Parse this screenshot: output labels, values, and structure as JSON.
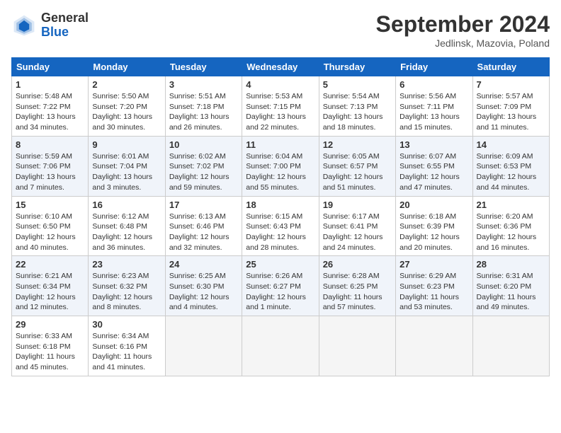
{
  "header": {
    "logo_general": "General",
    "logo_blue": "Blue",
    "month_title": "September 2024",
    "subtitle": "Jedlinsk, Mazovia, Poland"
  },
  "days_of_week": [
    "Sunday",
    "Monday",
    "Tuesday",
    "Wednesday",
    "Thursday",
    "Friday",
    "Saturday"
  ],
  "weeks": [
    {
      "shade": false,
      "days": [
        {
          "num": "1",
          "info": "Sunrise: 5:48 AM\nSunset: 7:22 PM\nDaylight: 13 hours\nand 34 minutes."
        },
        {
          "num": "2",
          "info": "Sunrise: 5:50 AM\nSunset: 7:20 PM\nDaylight: 13 hours\nand 30 minutes."
        },
        {
          "num": "3",
          "info": "Sunrise: 5:51 AM\nSunset: 7:18 PM\nDaylight: 13 hours\nand 26 minutes."
        },
        {
          "num": "4",
          "info": "Sunrise: 5:53 AM\nSunset: 7:15 PM\nDaylight: 13 hours\nand 22 minutes."
        },
        {
          "num": "5",
          "info": "Sunrise: 5:54 AM\nSunset: 7:13 PM\nDaylight: 13 hours\nand 18 minutes."
        },
        {
          "num": "6",
          "info": "Sunrise: 5:56 AM\nSunset: 7:11 PM\nDaylight: 13 hours\nand 15 minutes."
        },
        {
          "num": "7",
          "info": "Sunrise: 5:57 AM\nSunset: 7:09 PM\nDaylight: 13 hours\nand 11 minutes."
        }
      ]
    },
    {
      "shade": true,
      "days": [
        {
          "num": "8",
          "info": "Sunrise: 5:59 AM\nSunset: 7:06 PM\nDaylight: 13 hours\nand 7 minutes."
        },
        {
          "num": "9",
          "info": "Sunrise: 6:01 AM\nSunset: 7:04 PM\nDaylight: 13 hours\nand 3 minutes."
        },
        {
          "num": "10",
          "info": "Sunrise: 6:02 AM\nSunset: 7:02 PM\nDaylight: 12 hours\nand 59 minutes."
        },
        {
          "num": "11",
          "info": "Sunrise: 6:04 AM\nSunset: 7:00 PM\nDaylight: 12 hours\nand 55 minutes."
        },
        {
          "num": "12",
          "info": "Sunrise: 6:05 AM\nSunset: 6:57 PM\nDaylight: 12 hours\nand 51 minutes."
        },
        {
          "num": "13",
          "info": "Sunrise: 6:07 AM\nSunset: 6:55 PM\nDaylight: 12 hours\nand 47 minutes."
        },
        {
          "num": "14",
          "info": "Sunrise: 6:09 AM\nSunset: 6:53 PM\nDaylight: 12 hours\nand 44 minutes."
        }
      ]
    },
    {
      "shade": false,
      "days": [
        {
          "num": "15",
          "info": "Sunrise: 6:10 AM\nSunset: 6:50 PM\nDaylight: 12 hours\nand 40 minutes."
        },
        {
          "num": "16",
          "info": "Sunrise: 6:12 AM\nSunset: 6:48 PM\nDaylight: 12 hours\nand 36 minutes."
        },
        {
          "num": "17",
          "info": "Sunrise: 6:13 AM\nSunset: 6:46 PM\nDaylight: 12 hours\nand 32 minutes."
        },
        {
          "num": "18",
          "info": "Sunrise: 6:15 AM\nSunset: 6:43 PM\nDaylight: 12 hours\nand 28 minutes."
        },
        {
          "num": "19",
          "info": "Sunrise: 6:17 AM\nSunset: 6:41 PM\nDaylight: 12 hours\nand 24 minutes."
        },
        {
          "num": "20",
          "info": "Sunrise: 6:18 AM\nSunset: 6:39 PM\nDaylight: 12 hours\nand 20 minutes."
        },
        {
          "num": "21",
          "info": "Sunrise: 6:20 AM\nSunset: 6:36 PM\nDaylight: 12 hours\nand 16 minutes."
        }
      ]
    },
    {
      "shade": true,
      "days": [
        {
          "num": "22",
          "info": "Sunrise: 6:21 AM\nSunset: 6:34 PM\nDaylight: 12 hours\nand 12 minutes."
        },
        {
          "num": "23",
          "info": "Sunrise: 6:23 AM\nSunset: 6:32 PM\nDaylight: 12 hours\nand 8 minutes."
        },
        {
          "num": "24",
          "info": "Sunrise: 6:25 AM\nSunset: 6:30 PM\nDaylight: 12 hours\nand 4 minutes."
        },
        {
          "num": "25",
          "info": "Sunrise: 6:26 AM\nSunset: 6:27 PM\nDaylight: 12 hours\nand 1 minute."
        },
        {
          "num": "26",
          "info": "Sunrise: 6:28 AM\nSunset: 6:25 PM\nDaylight: 11 hours\nand 57 minutes."
        },
        {
          "num": "27",
          "info": "Sunrise: 6:29 AM\nSunset: 6:23 PM\nDaylight: 11 hours\nand 53 minutes."
        },
        {
          "num": "28",
          "info": "Sunrise: 6:31 AM\nSunset: 6:20 PM\nDaylight: 11 hours\nand 49 minutes."
        }
      ]
    },
    {
      "shade": false,
      "days": [
        {
          "num": "29",
          "info": "Sunrise: 6:33 AM\nSunset: 6:18 PM\nDaylight: 11 hours\nand 45 minutes."
        },
        {
          "num": "30",
          "info": "Sunrise: 6:34 AM\nSunset: 6:16 PM\nDaylight: 11 hours\nand 41 minutes."
        },
        null,
        null,
        null,
        null,
        null
      ]
    }
  ]
}
